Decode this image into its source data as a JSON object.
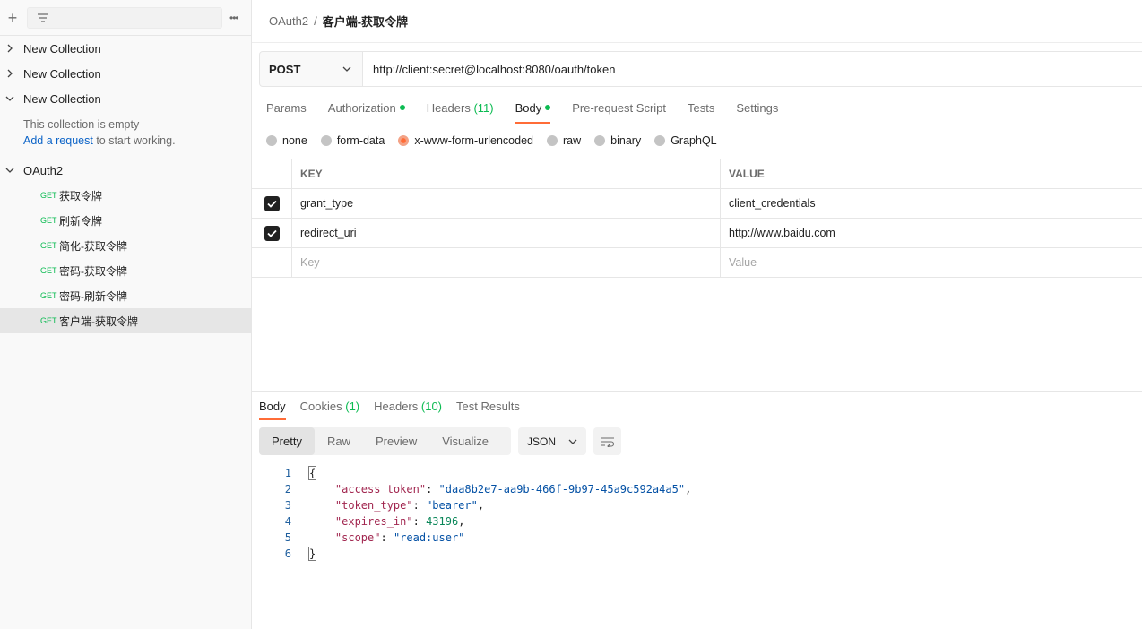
{
  "sidebar": {
    "collections": [
      {
        "name": "New Collection",
        "expanded": false
      },
      {
        "name": "New Collection",
        "expanded": false
      },
      {
        "name": "New Collection",
        "expanded": true
      }
    ],
    "empty_text": "This collection is empty",
    "empty_link": "Add a request",
    "empty_suffix": " to start working.",
    "oauth_collection": "OAuth2",
    "requests": [
      {
        "method": "GET",
        "name": "获取令牌"
      },
      {
        "method": "GET",
        "name": "刷新令牌"
      },
      {
        "method": "GET",
        "name": "简化-获取令牌"
      },
      {
        "method": "GET",
        "name": "密码-获取令牌"
      },
      {
        "method": "GET",
        "name": "密码-刷新令牌"
      },
      {
        "method": "GET",
        "name": "客户端-获取令牌"
      }
    ]
  },
  "breadcrumb": {
    "parent": "OAuth2",
    "separator": "/",
    "current": "客户端-获取令牌"
  },
  "request": {
    "method": "POST",
    "url": "http://client:secret@localhost:8080/oauth/token"
  },
  "tabs": {
    "params": "Params",
    "authorization": "Authorization",
    "headers": "Headers",
    "headers_count": "(11)",
    "body": "Body",
    "prerequest": "Pre-request Script",
    "tests": "Tests",
    "settings": "Settings"
  },
  "body_types": [
    "none",
    "form-data",
    "x-www-form-urlencoded",
    "raw",
    "binary",
    "GraphQL"
  ],
  "kv_table": {
    "key_header": "KEY",
    "value_header": "VALUE",
    "rows": [
      {
        "key": "grant_type",
        "value": "client_credentials"
      },
      {
        "key": "redirect_uri",
        "value": "http://www.baidu.com"
      }
    ],
    "key_placeholder": "Key",
    "value_placeholder": "Value"
  },
  "response": {
    "tabs": {
      "body": "Body",
      "cookies": "Cookies",
      "cookies_count": "(1)",
      "headers": "Headers",
      "headers_count": "(10)",
      "tests": "Test Results"
    },
    "views": [
      "Pretty",
      "Raw",
      "Preview",
      "Visualize"
    ],
    "format": "JSON",
    "lines": [
      {
        "n": "1",
        "text": "{"
      },
      {
        "n": "2",
        "key": "\"access_token\"",
        "value": "\"daa8b2e7-aa9b-466f-9b97-45a9c592a4a5\"",
        "tail": ","
      },
      {
        "n": "3",
        "key": "\"token_type\"",
        "value": "\"bearer\"",
        "tail": ","
      },
      {
        "n": "4",
        "key": "\"expires_in\"",
        "num": "43196",
        "tail": ","
      },
      {
        "n": "5",
        "key": "\"scope\"",
        "value": "\"read:user\"",
        "tail": ""
      },
      {
        "n": "6",
        "text": "}"
      }
    ]
  },
  "colors": {
    "accent": "#ff6c37",
    "get": "#0cbb52",
    "link": "#0b63c7"
  }
}
